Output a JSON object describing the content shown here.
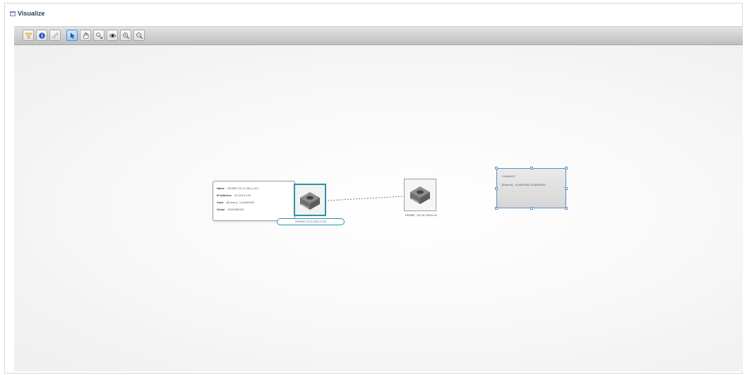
{
  "window": {
    "title": "Visualize"
  },
  "toolbar": {
    "buttons": [
      {
        "name": "filter-icon",
        "active": false
      },
      {
        "name": "info-icon",
        "active": false
      },
      {
        "name": "edit-icon",
        "active": false
      },
      {
        "name": "pointer-icon",
        "active": true
      },
      {
        "name": "hand-pan-icon",
        "active": false
      },
      {
        "name": "select-node-icon",
        "active": false
      },
      {
        "name": "view-icon",
        "active": false
      },
      {
        "name": "zoom-in-icon",
        "active": false
      },
      {
        "name": "zoom-out-icon",
        "active": false
      }
    ]
  },
  "tooltip": {
    "rows": [
      {
        "key": "Name",
        "value": "NSSMF-VX-0-106-4-143"
      },
      {
        "key": "IP Address",
        "value": "10.106.4.143"
      },
      {
        "key": "Zone",
        "value": "[Emorm] - VLANHG63"
      },
      {
        "key": "Serial",
        "value": "1951SB0025"
      }
    ]
  },
  "nodes": {
    "node_a_label": "NSSMF-VX-0-106-4-143",
    "node_b_label": "NSSMF_VX-10.106.4L41"
  },
  "vlan": {
    "title": "VLANHG2",
    "description": "[Emorm] - VLANHG63 VLANHG63"
  },
  "colors": {
    "selection": "#2e93a6",
    "toolbar_active": "#4f8fcb",
    "link": "#7a7a7a"
  }
}
